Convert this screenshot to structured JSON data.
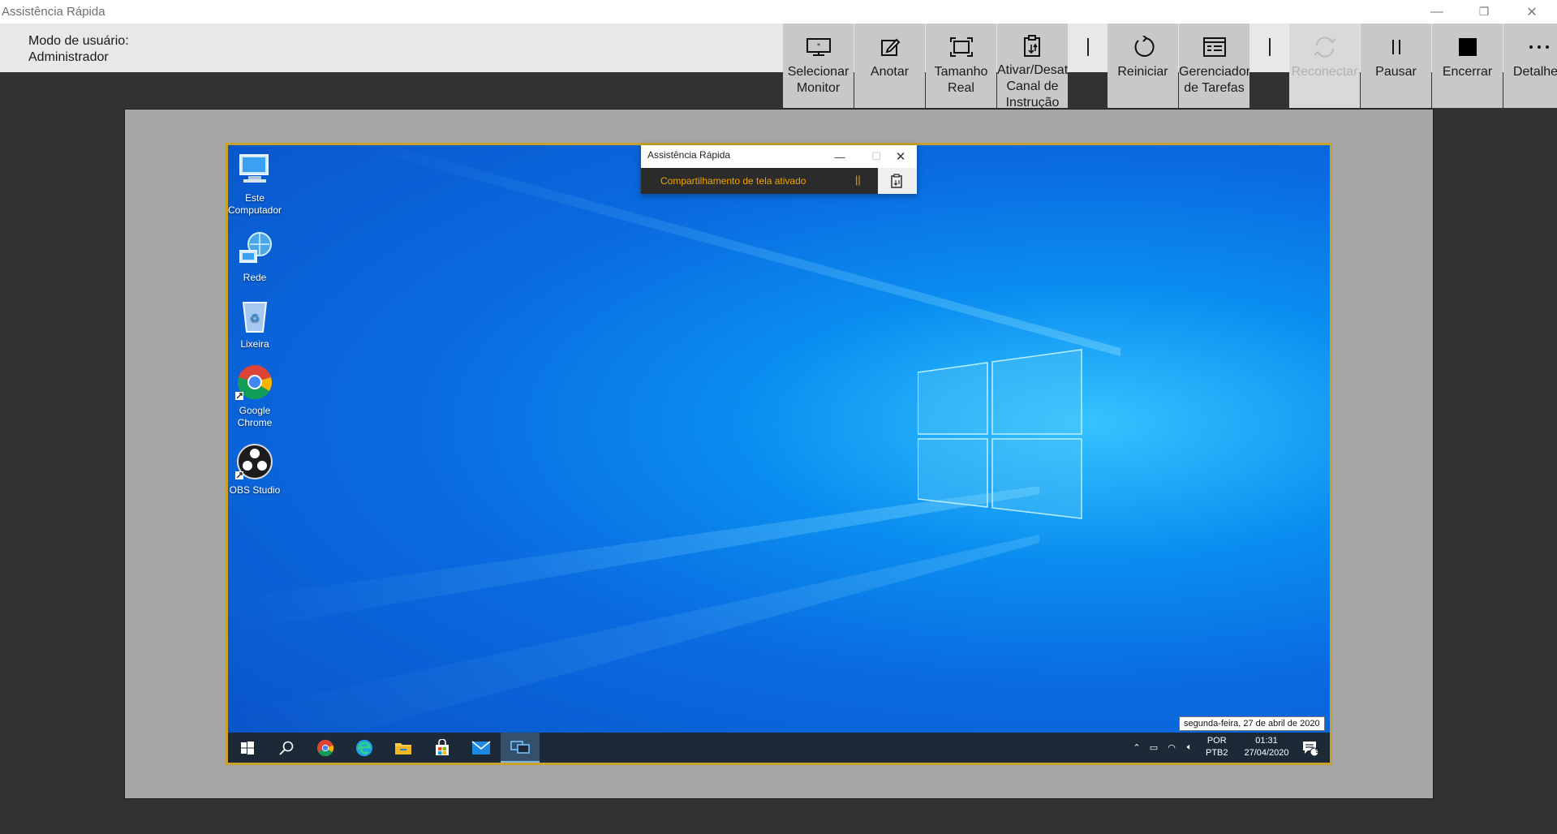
{
  "window": {
    "title": "Assistência Rápida",
    "controls": {
      "minimize": "—",
      "restore": "❐",
      "close": "✕"
    }
  },
  "header": {
    "user_mode_label": "Modo de usuário:",
    "user_mode_value": "Administrador"
  },
  "toolbar": {
    "buttons": [
      {
        "label": "Selecionar\nMonitor",
        "icon": "monitor-icon"
      },
      {
        "label": "Anotar",
        "icon": "pen-icon"
      },
      {
        "label": "Tamanho\nReal",
        "icon": "actual-size-icon"
      },
      {
        "label": "Ativar/Desat\nCanal de\nInstrução",
        "icon": "clipboard-icon"
      },
      {
        "label": "Reiniciar",
        "icon": "restart-icon"
      },
      {
        "label": "Gerenciador\nde Tarefas",
        "icon": "task-manager-icon"
      },
      {
        "label": "Reconectar",
        "icon": "reconnect-icon"
      },
      {
        "label": "Pausar",
        "icon": "pause-icon"
      },
      {
        "label": "Encerrar",
        "icon": "stop-icon"
      },
      {
        "label": "Detalhes",
        "icon": "more-icon"
      }
    ]
  },
  "desktop": {
    "icons": [
      {
        "label": "Este\nComputador",
        "icon": "computer-icon"
      },
      {
        "label": "Rede",
        "icon": "network-icon"
      },
      {
        "label": "Lixeira",
        "icon": "recycle-bin-icon"
      },
      {
        "label": "Google\nChrome",
        "icon": "chrome-icon"
      },
      {
        "label": "OBS Studio",
        "icon": "obs-icon"
      }
    ],
    "date_tooltip": "segunda-feira, 27 de abril de 2020"
  },
  "quick_assist": {
    "title": "Assistência Rápida",
    "status": "Compartilhamento de tela ativado",
    "pause_glyph": "||"
  },
  "taskbar": {
    "items": [
      "windows-start-icon",
      "search-icon",
      "chrome-icon",
      "edge-icon",
      "file-explorer-icon",
      "store-icon",
      "mail-icon",
      "quick-assist-icon"
    ],
    "lang_top": "POR",
    "lang_bottom": "PTB2",
    "time": "01:31",
    "date": "27/04/2020",
    "notifications": "9"
  },
  "colors": {
    "toolbar_button": "#c8c8c8",
    "frame_border": "#c8a22a",
    "status_text": "#f0a400",
    "desktop_blue": "#0a8ef0"
  }
}
